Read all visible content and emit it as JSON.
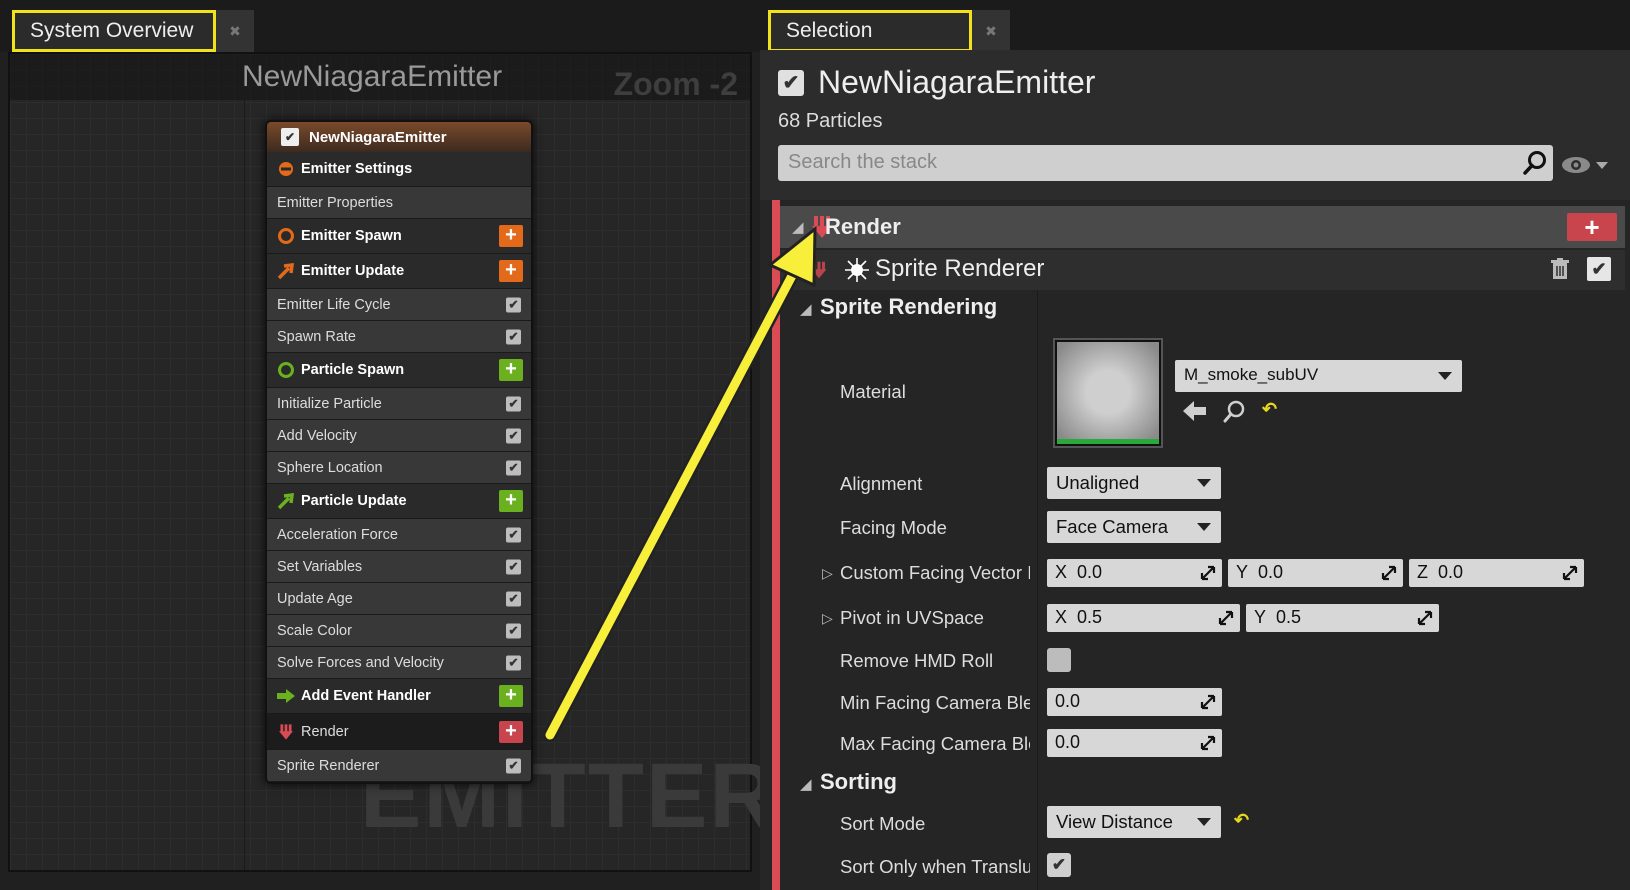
{
  "left_panel": {
    "tab_title": "System Overview",
    "graph_title": "NewNiagaraEmitter",
    "zoom_label": "Zoom -2",
    "watermark": "EMITTER",
    "node": {
      "title": "NewNiagaraEmitter",
      "rows": [
        {
          "label": "Emitter Settings",
          "type": "section",
          "icon": "emitter-settings-icon"
        },
        {
          "label": "Emitter Properties",
          "type": "item"
        },
        {
          "label": "Emitter Spawn",
          "type": "section",
          "icon": "emitter-spawn-icon",
          "add": "orange"
        },
        {
          "label": "Emitter Update",
          "type": "section",
          "icon": "emitter-update-icon",
          "add": "orange"
        },
        {
          "label": "Emitter Life Cycle",
          "type": "item",
          "check": true
        },
        {
          "label": "Spawn Rate",
          "type": "item",
          "check": true
        },
        {
          "label": "Particle Spawn",
          "type": "section",
          "icon": "particle-spawn-icon",
          "add": "green"
        },
        {
          "label": "Initialize Particle",
          "type": "item",
          "check": true
        },
        {
          "label": "Add Velocity",
          "type": "item",
          "check": true
        },
        {
          "label": "Sphere Location",
          "type": "item",
          "check": true
        },
        {
          "label": "Particle Update",
          "type": "section",
          "icon": "particle-update-icon",
          "add": "green"
        },
        {
          "label": "Acceleration Force",
          "type": "item",
          "check": true
        },
        {
          "label": "Set Variables",
          "type": "item",
          "check": true
        },
        {
          "label": "Update Age",
          "type": "item",
          "check": true
        },
        {
          "label": "Scale Color",
          "type": "item",
          "check": true
        },
        {
          "label": "Solve Forces and Velocity",
          "type": "item",
          "check": true
        },
        {
          "label": "Add Event Handler",
          "type": "section",
          "icon": "event-handler-icon",
          "add": "green"
        },
        {
          "label": "Render",
          "type": "selected",
          "icon": "render-icon",
          "add": "red"
        },
        {
          "label": "Sprite Renderer",
          "type": "item",
          "check": true
        }
      ]
    }
  },
  "right_panel": {
    "tab_title": "Selection",
    "emitter_name": "NewNiagaraEmitter",
    "particles": "68 Particles",
    "search_placeholder": "Search the stack",
    "render_label": "Render",
    "sprite_renderer_label": "Sprite Renderer",
    "categories": {
      "sprite_rendering": "Sprite Rendering",
      "sorting": "Sorting"
    },
    "properties": {
      "material": {
        "label": "Material",
        "value": "M_smoke_subUV"
      },
      "alignment": {
        "label": "Alignment",
        "value": "Unaligned"
      },
      "facing_mode": {
        "label": "Facing Mode",
        "value": "Face Camera"
      },
      "custom_facing": {
        "label": "Custom Facing Vector I",
        "x_axis": "X",
        "x": "0.0",
        "y_axis": "Y",
        "y": "0.0",
        "z_axis": "Z",
        "z": "0.0"
      },
      "pivot": {
        "label": "Pivot in UVSpace",
        "x_axis": "X",
        "x": "0.5",
        "y_axis": "Y",
        "y": "0.5"
      },
      "remove_hmd_roll": {
        "label": "Remove HMD Roll"
      },
      "min_facing": {
        "label": "Min Facing Camera Blei",
        "value": "0.0"
      },
      "max_facing": {
        "label": "Max Facing Camera Ble",
        "value": "0.0"
      },
      "sort_mode": {
        "label": "Sort Mode",
        "value": "View Distance"
      },
      "sort_only": {
        "label": "Sort Only when Translu"
      }
    }
  },
  "colors": {
    "highlight": "#f2e21a",
    "render_red": "#d94c55",
    "selected_orange": "#e8a20a",
    "add_orange": "#e36a1b",
    "add_green": "#6ab01f"
  }
}
